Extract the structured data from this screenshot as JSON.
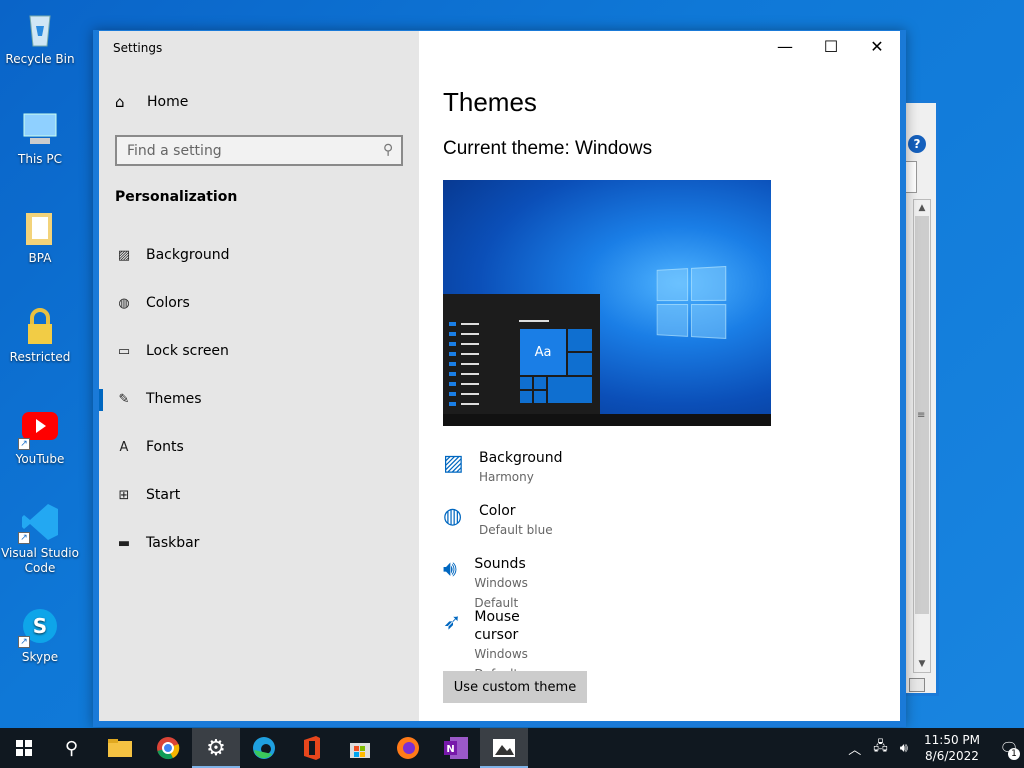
{
  "desktop": {
    "icons": [
      {
        "label": "Recycle Bin"
      },
      {
        "label": "This PC"
      },
      {
        "label": "BPA"
      },
      {
        "label": "Restricted"
      },
      {
        "label": "YouTube"
      },
      {
        "label": "Visual Studio Code"
      },
      {
        "label": "Skype"
      }
    ]
  },
  "window": {
    "title": "Settings",
    "minimize": "—",
    "maximize": "☐",
    "close": "✕"
  },
  "sidebar": {
    "home_label": "Home",
    "search_placeholder": "Find a setting",
    "section_title": "Personalization",
    "items": [
      {
        "label": "Background",
        "icon": "image-icon"
      },
      {
        "label": "Colors",
        "icon": "palette-icon"
      },
      {
        "label": "Lock screen",
        "icon": "lock-screen-icon"
      },
      {
        "label": "Themes",
        "icon": "themes-icon",
        "active": true
      },
      {
        "label": "Fonts",
        "icon": "fonts-icon"
      },
      {
        "label": "Start",
        "icon": "start-icon"
      },
      {
        "label": "Taskbar",
        "icon": "taskbar-icon"
      }
    ]
  },
  "main": {
    "title": "Themes",
    "current_theme": "Current theme: Windows",
    "preview_tile": "Aa",
    "items": [
      {
        "title": "Background",
        "value": "Harmony",
        "icon": "image-icon"
      },
      {
        "title": "Color",
        "value": "Default blue",
        "icon": "palette-icon"
      },
      {
        "title": "Sounds",
        "value": "Windows Default",
        "icon": "speaker-icon"
      },
      {
        "title": "Mouse cursor",
        "value": "Windows Default",
        "icon": "cursor-icon"
      }
    ],
    "custom_button": "Use custom theme"
  },
  "taskbar": {
    "apps": [
      "start",
      "search",
      "file-explorer",
      "chrome",
      "settings",
      "edge",
      "office",
      "store",
      "firefox",
      "onenote",
      "photos"
    ],
    "time": "11:50 PM",
    "date": "8/6/2022",
    "notification_count": "1"
  },
  "colors": {
    "accent": "#0067c0",
    "desktop": "#0f78d7",
    "taskbar": "#101820"
  }
}
